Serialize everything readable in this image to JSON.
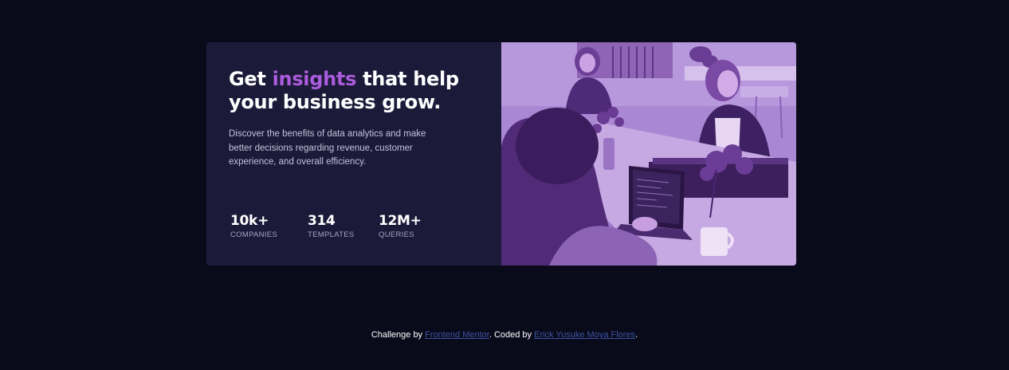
{
  "card": {
    "headline": {
      "before": "Get ",
      "accent": "insights",
      "after": " that help your business grow."
    },
    "description": "Discover the benefits of data analytics and make better decisions regarding revenue, customer experience, and overall efficiency.",
    "stats": [
      {
        "value": "10k+",
        "label": "COMPANIES"
      },
      {
        "value": "314",
        "label": "TEMPLATES"
      },
      {
        "value": "12M+",
        "label": "QUERIES"
      }
    ],
    "image_icon": "office-team-photo"
  },
  "footer": {
    "prefix": "Challenge by ",
    "link1": "Frontend Mentor",
    "middle": ". Coded by ",
    "link2": "Erick Yusuke Moya Flores",
    "suffix": "."
  },
  "colors": {
    "background": "#090b1b",
    "card": "#1c1a39",
    "accent": "#aa5cdb",
    "image_tint": "#a57fce",
    "link": "#3e52a3"
  }
}
